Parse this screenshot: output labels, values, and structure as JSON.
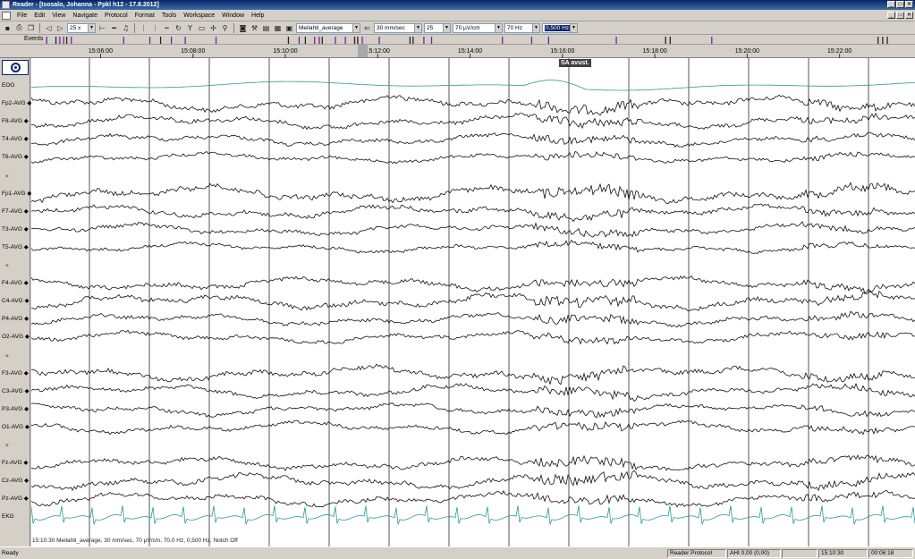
{
  "window": {
    "title": "Reader - [Isosalo, Johanna - Ppkl h12 - 17.8.2012]",
    "buttons": [
      "_",
      "□",
      "✕"
    ]
  },
  "menu": {
    "items": [
      "File",
      "Edit",
      "View",
      "Navigate",
      "Protocol",
      "Format",
      "Tools",
      "Workspace",
      "Window",
      "Help"
    ]
  },
  "toolbar": {
    "zoom": "25 x",
    "montage": "Meilahti_average",
    "speed": "30 mm/sec",
    "channels_shown": "25",
    "sensitivity": "70 µV/cm",
    "low_pass": "70 Hz",
    "high_pass": "0,500 Hz",
    "icons": [
      "save-icon",
      "print-icon",
      "copy-icon",
      "prev-icon",
      "next-icon",
      "music-note-icon",
      "undo-icon",
      "filter-icon",
      "select-rect-icon",
      "zoom-icon",
      "camera-icon",
      "tools-icon",
      "film-icon",
      "calc-icon",
      "arrow-left-icon"
    ]
  },
  "events": {
    "label": "Events",
    "colors": {
      "purple": "#7a1fa0",
      "dark": "#222222"
    },
    "marks": [
      {
        "t": "15:04:50",
        "c": "purple"
      },
      {
        "t": "15:05:02",
        "c": "dark"
      },
      {
        "t": "15:05:07",
        "c": "purple"
      },
      {
        "t": "15:05:12",
        "c": "purple"
      },
      {
        "t": "15:05:16",
        "c": "dark"
      },
      {
        "t": "15:05:22",
        "c": "purple"
      },
      {
        "t": "15:06:30",
        "c": "purple"
      },
      {
        "t": "15:07:04",
        "c": "purple"
      },
      {
        "t": "15:07:18",
        "c": "dark"
      },
      {
        "t": "15:07:32",
        "c": "purple"
      },
      {
        "t": "15:07:50",
        "c": "purple"
      },
      {
        "t": "15:08:30",
        "c": "purple"
      },
      {
        "t": "15:10:04",
        "c": "dark"
      },
      {
        "t": "15:10:18",
        "c": "purple"
      },
      {
        "t": "15:10:26",
        "c": "dark"
      },
      {
        "t": "15:10:38",
        "c": "purple"
      },
      {
        "t": "15:10:44",
        "c": "purple"
      },
      {
        "t": "15:10:48",
        "c": "dark"
      },
      {
        "t": "15:11:05",
        "c": "purple"
      },
      {
        "t": "15:11:18",
        "c": "purple"
      },
      {
        "t": "15:11:30",
        "c": "dark"
      },
      {
        "t": "15:11:34",
        "c": "dark"
      },
      {
        "t": "15:11:40",
        "c": "purple"
      },
      {
        "t": "15:12:02",
        "c": "purple"
      },
      {
        "t": "15:12:42",
        "c": "dark"
      },
      {
        "t": "15:12:46",
        "c": "dark"
      },
      {
        "t": "15:13:00",
        "c": "purple"
      },
      {
        "t": "15:13:10",
        "c": "purple"
      },
      {
        "t": "15:14:42",
        "c": "purple"
      },
      {
        "t": "15:15:20",
        "c": "purple"
      },
      {
        "t": "15:15:42",
        "c": "purple"
      },
      {
        "t": "15:17:10",
        "c": "purple"
      },
      {
        "t": "15:18:14",
        "c": "dark"
      },
      {
        "t": "15:18:20",
        "c": "dark"
      },
      {
        "t": "15:19:14",
        "c": "purple"
      },
      {
        "t": "15:22:50",
        "c": "dark"
      },
      {
        "t": "15:22:56",
        "c": "dark"
      },
      {
        "t": "15:23:02",
        "c": "dark"
      }
    ]
  },
  "timeline": {
    "start": "15:04:30",
    "end": "15:23:38",
    "ticks": [
      "15:06:00",
      "15:08:00",
      "15:10:00",
      "15:12:00",
      "15:14:00",
      "15:16:00",
      "15:18:00",
      "15:20:00",
      "15:22:00"
    ],
    "view_marker": "15:10:30"
  },
  "channels": [
    {
      "label": "EOG",
      "color": "#2a9a9a",
      "type": "eog",
      "amp": 3
    },
    {
      "label": "Fp2-AVG",
      "amp": 9
    },
    {
      "label": "F8-AVG",
      "amp": 8
    },
    {
      "label": "T4-AVG",
      "amp": 7
    },
    {
      "label": "T6-AVG",
      "amp": 6
    },
    {
      "label": "",
      "sep": true
    },
    {
      "label": "Fp1-AVG",
      "amp": 10
    },
    {
      "label": "F7-AVG",
      "amp": 8
    },
    {
      "label": "T3-AVG",
      "amp": 7
    },
    {
      "label": "T5-AVG",
      "amp": 6
    },
    {
      "label": "",
      "sep": true
    },
    {
      "label": "F4-AVG",
      "amp": 8
    },
    {
      "label": "C4-AVG",
      "amp": 9
    },
    {
      "label": "P4-AVG",
      "amp": 7
    },
    {
      "label": "O2-AVG",
      "amp": 7
    },
    {
      "label": "",
      "sep": true
    },
    {
      "label": "F3-AVG",
      "amp": 9
    },
    {
      "label": "C3-AVG",
      "amp": 8
    },
    {
      "label": "P3-AVG",
      "amp": 7
    },
    {
      "label": "O1-AVG",
      "amp": 7
    },
    {
      "label": "",
      "sep": true
    },
    {
      "label": "Fz-AVG",
      "amp": 8
    },
    {
      "label": "Cz-AVG",
      "amp": 9
    },
    {
      "label": "Pz-AVG",
      "amp": 8
    },
    {
      "label": "EKG",
      "color": "#2a9a9a",
      "type": "ekg",
      "amp": 10
    }
  ],
  "event_tag": "SA avust.",
  "info_line": "15:10:30 Meilahti_average, 30 mm/sec, 70 µV/cm, 70,0 Hz, 0,500 Hz, Notch Off",
  "status": {
    "ready": "Ready",
    "protocol": "Reader Protocol",
    "ahi": "AHI 0,00 (0,00)",
    "time": "15:10:30",
    "duration": "00:06:18"
  }
}
